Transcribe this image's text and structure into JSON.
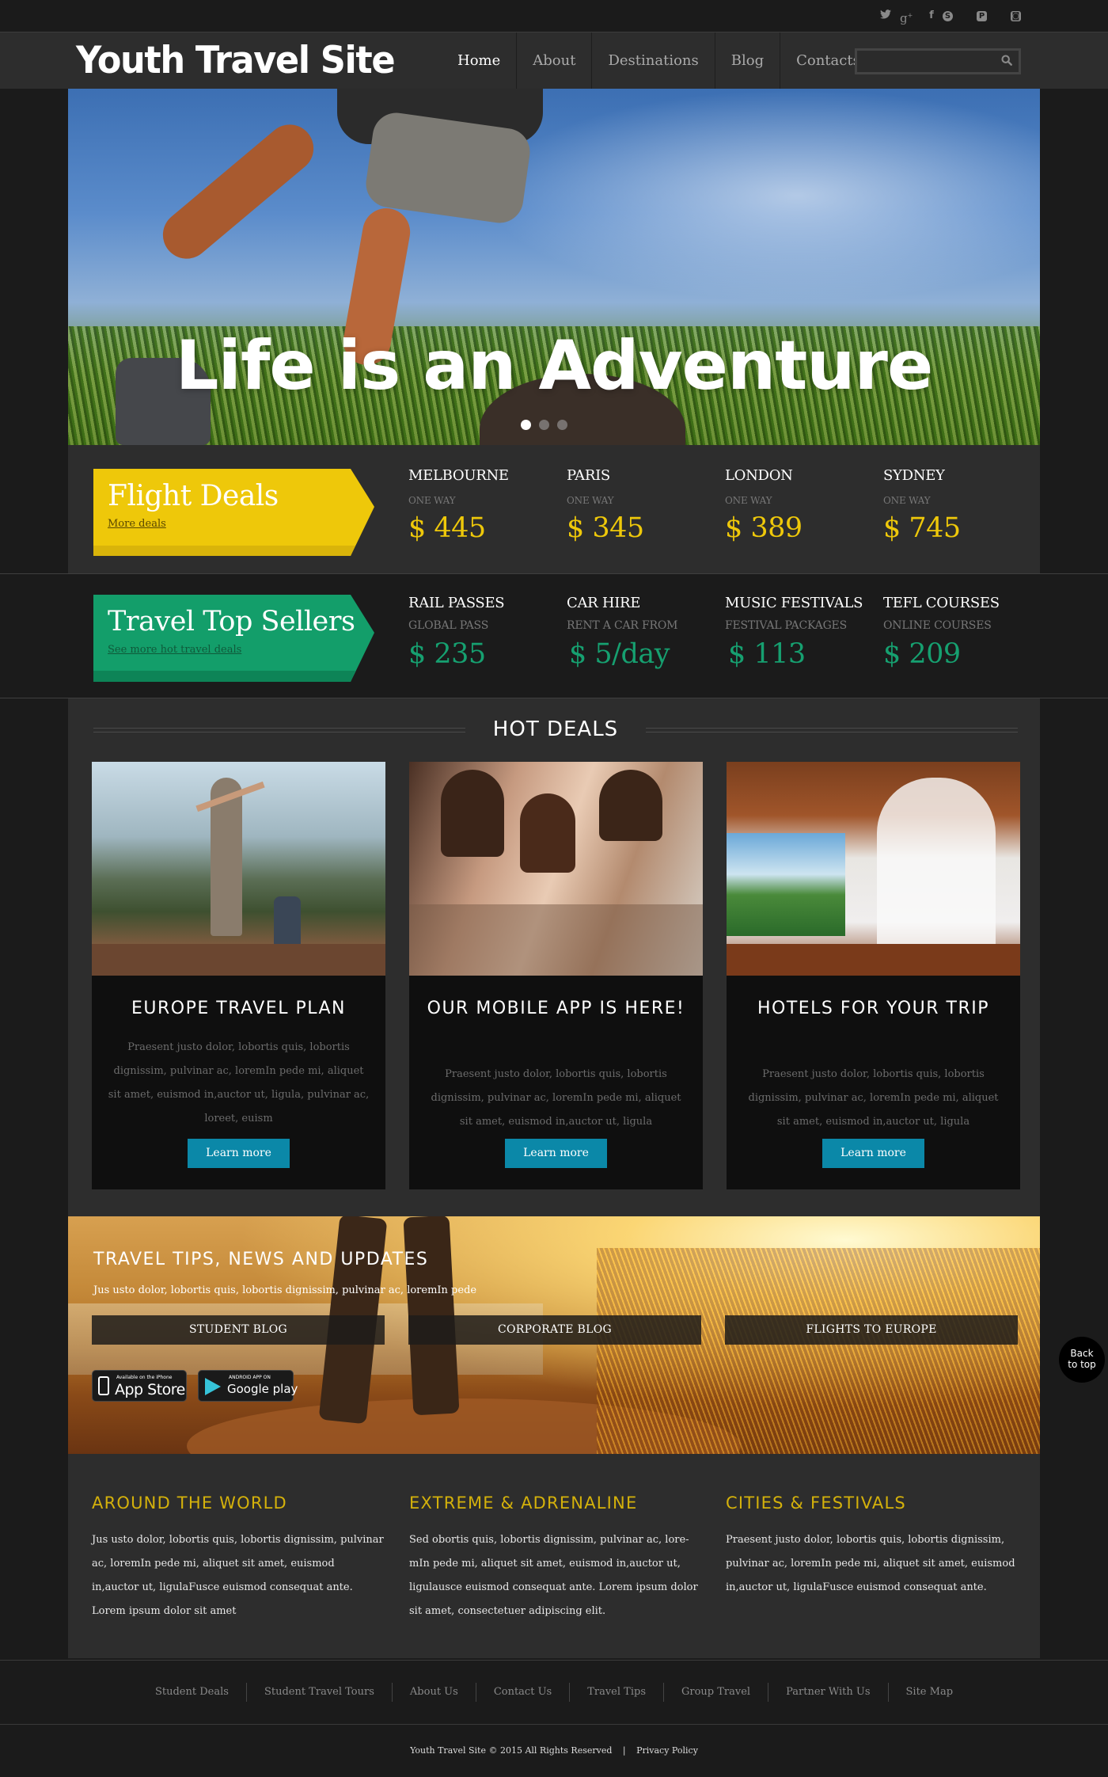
{
  "social": {
    "icons": [
      "twitter-icon",
      "google-plus-icon",
      "facebook-icon",
      "skype-icon",
      "pinterest-icon",
      "instagram-icon"
    ],
    "glyphs": [
      "🐦",
      "g+",
      "f",
      "S",
      "P",
      "◙"
    ]
  },
  "header": {
    "logo": "Youth Travel Site",
    "nav": [
      {
        "label": "Home",
        "active": true
      },
      {
        "label": "About",
        "active": false
      },
      {
        "label": "Destinations",
        "active": false
      },
      {
        "label": "Blog",
        "active": false
      },
      {
        "label": "Contacts",
        "active": false
      }
    ],
    "search": {
      "value": "",
      "placeholder": ""
    }
  },
  "hero": {
    "title": "Life is an Adventure",
    "slides": 3,
    "active_slide": 1
  },
  "flight_deals": {
    "title": "Flight Deals",
    "link": "More deals",
    "color": "#eec80a",
    "items": [
      {
        "city": "MELBOURNE",
        "sub": "ONE WAY",
        "price": "$ 445"
      },
      {
        "city": "PARIS",
        "sub": "ONE WAY",
        "price": "$ 345"
      },
      {
        "city": "LONDON",
        "sub": "ONE WAY",
        "price": "$ 389"
      },
      {
        "city": "SYDNEY",
        "sub": "ONE WAY",
        "price": "$ 745"
      }
    ]
  },
  "top_sellers": {
    "title": "Travel Top Sellers",
    "link": "See more hot travel deals",
    "color": "#16a070",
    "items": [
      {
        "city": "RAIL PASSES",
        "sub": "GLOBAL PASS",
        "price": "$ 235"
      },
      {
        "city": "CAR HIRE",
        "sub": "RENT A CAR FROM",
        "price": "$ 5/day"
      },
      {
        "city": "MUSIC FESTIVALS",
        "sub": "FESTIVAL PACKAGES",
        "price": "$ 113"
      },
      {
        "city": "TEFL COURSES",
        "sub": "ONLINE COURSES",
        "price": "$ 209"
      }
    ]
  },
  "hot_deals": {
    "title": "HOT DEALS",
    "cards": [
      {
        "title": "EUROPE TRAVEL PLAN",
        "text": "Praesent justo dolor, lobortis quis, lobortis dignissim, pulvinar ac, loremIn pede mi, aliquet sit amet, euismod in,auctor ut, ligula, pulvinar ac, loreet, euism",
        "button": "Learn more"
      },
      {
        "title": "OUR MOBILE APP IS HERE!",
        "text": "Praesent justo dolor, lobortis quis, lobortis dignissim, pulvinar ac, loremIn pede mi, aliquet sit amet, euismod in,auctor ut, ligula",
        "button": "Learn more"
      },
      {
        "title": "HOTELS FOR YOUR TRIP",
        "text": "Praesent justo dolor, lobortis quis, lobortis dignissim, pulvinar ac, loremIn pede mi, aliquet sit amet, euismod in,auctor ut, ligula",
        "button": "Learn more"
      }
    ],
    "button_color": "#0b88a8"
  },
  "tips": {
    "title": "TRAVEL TIPS, NEWS AND UPDATES",
    "lead": "Jus usto dolor, lobortis quis, lobortis dignissim, pulvinar ac, loremIn pede",
    "buttons": [
      "STUDENT BLOG",
      "CORPORATE BLOG",
      "FLIGHTS TO EUROPE"
    ],
    "app_store": {
      "small": "Available on the iPhone",
      "big": "App Store"
    },
    "google_play": {
      "small": "ANDROID APP ON",
      "big": "Google play"
    }
  },
  "info": {
    "heading_color": "#d4b10b",
    "columns": [
      {
        "title": "AROUND THE WORLD",
        "text": "Jus usto dolor, lobortis quis, lobortis dignissim, pulvinar ac, loremIn pede mi, aliquet sit amet, euismod in,auctor ut, ligulaFusce euismod consequat ante. Lorem ipsum dolor sit amet"
      },
      {
        "title": "EXTREME & ADRENALINE",
        "text": "Sed obortis quis, lobortis dignissim, pulvinar ac, lore-mIn pede mi, aliquet sit amet, euismod in,auctor ut, ligulausce euismod consequat ante. Lorem ipsum dolor sit amet, consectetuer adipiscing elit."
      },
      {
        "title": "CITIES & FESTIVALS",
        "text": "Praesent justo dolor, lobortis quis, lobortis dignissim, pulvinar ac, loremIn pede mi, aliquet sit amet, euismod in,auctor ut, ligulaFusce euismod consequat ante."
      }
    ]
  },
  "footer": {
    "links": [
      "Student Deals",
      "Student Travel Tours",
      "About Us",
      "Contact Us",
      "Travel Tips",
      "Group Travel",
      "Partner With Us",
      "Site Map"
    ],
    "copyright": "Youth Travel Site © 2015 All Rights Reserved",
    "separator": "|",
    "privacy": "Privacy Policy"
  },
  "back_to_top": {
    "line1": "Back",
    "line2": "to top"
  }
}
